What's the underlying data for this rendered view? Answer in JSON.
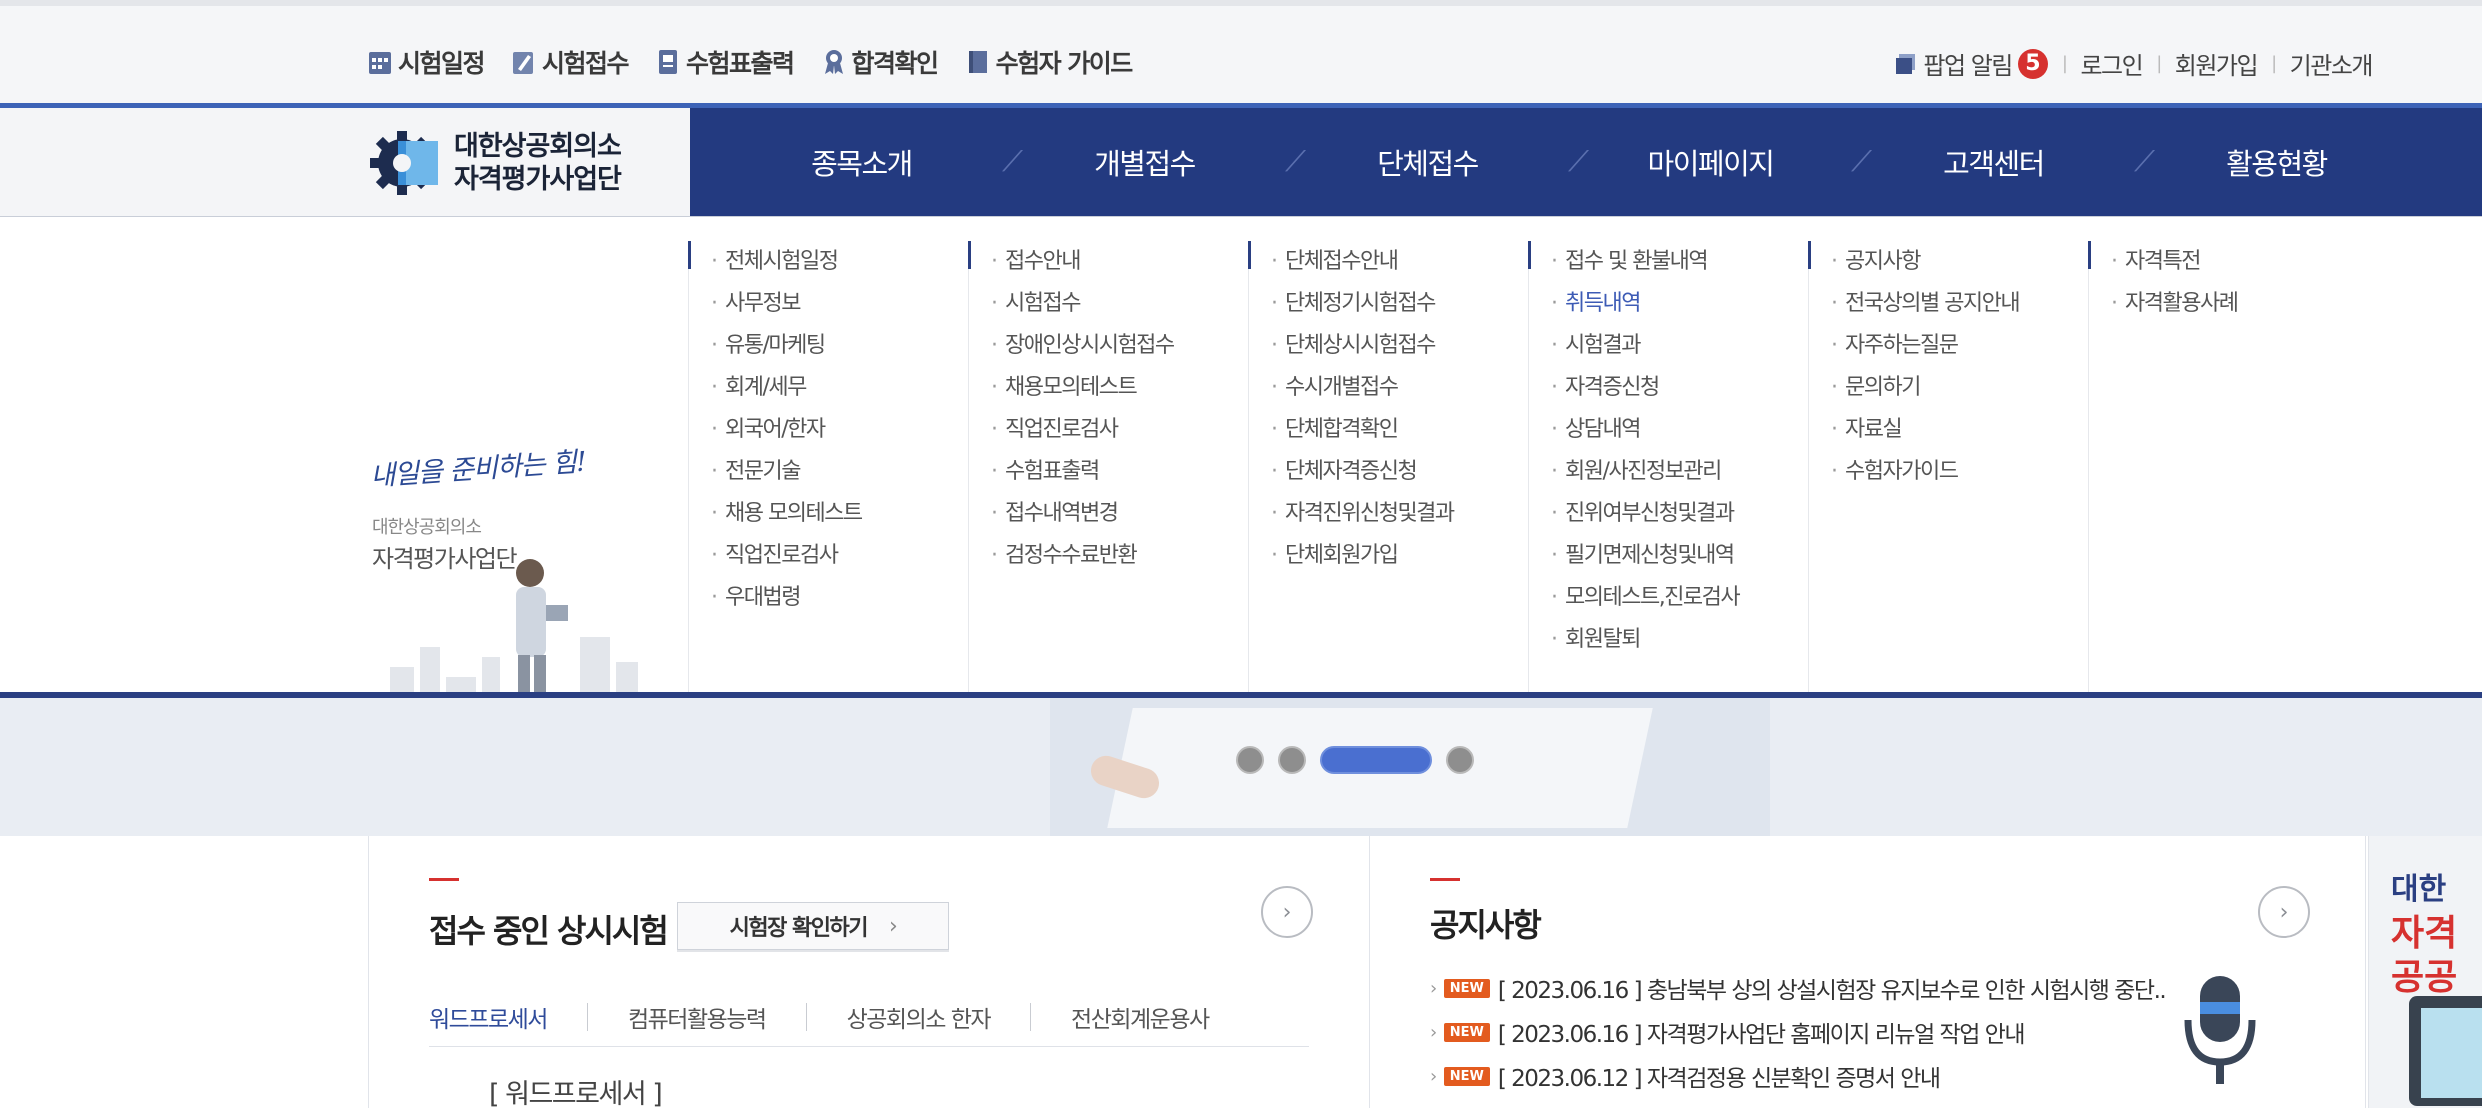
{
  "quick_links": [
    {
      "label": "시험일정",
      "icon": "calendar-icon"
    },
    {
      "label": "시험접수",
      "icon": "edit-icon"
    },
    {
      "label": "수험표출력",
      "icon": "id-card-icon"
    },
    {
      "label": "합격확인",
      "icon": "ribbon-icon"
    },
    {
      "label": "수험자 가이드",
      "icon": "book-icon"
    }
  ],
  "account": {
    "popup_label": "팝업 알림",
    "popup_count": "5",
    "login": "로그인",
    "signup": "회원가입",
    "about": "기관소개"
  },
  "logo": {
    "line1": "대한상공회의소",
    "line2": "자격평가사업단"
  },
  "menu": [
    "종목소개",
    "개별접수",
    "단체접수",
    "마이페이지",
    "고객센터",
    "활용현황"
  ],
  "submenu": [
    [
      "전체시험일정",
      "사무정보",
      "유통/마케팅",
      "회계/세무",
      "외국어/한자",
      "전문기술",
      "채용 모의테스트",
      "직업진로검사",
      "우대법령"
    ],
    [
      "접수안내",
      "시험접수",
      "장애인상시시험접수",
      "채용모의테스트",
      "직업진로검사",
      "수험표출력",
      "접수내역변경",
      "검정수수료반환"
    ],
    [
      "단체접수안내",
      "단체정기시험접수",
      "단체상시시험접수",
      "수시개별접수",
      "단체합격확인",
      "단체자격증신청",
      "자격진위신청및결과",
      "단체회원가입"
    ],
    [
      "접수 및 환불내역",
      "취득내역",
      "시험결과",
      "자격증신청",
      "상담내역",
      "회원/사진정보관리",
      "진위여부신청및결과",
      "필기면제신청및내역",
      "모의테스트,진로검사",
      "회원탈퇴"
    ],
    [
      "공지사항",
      "전국상의별 공지안내",
      "자주하는질문",
      "문의하기",
      "자료실",
      "수험자가이드"
    ],
    [
      "자격특전",
      "자격활용사례"
    ]
  ],
  "submenu_active": "취득내역",
  "promo": {
    "script": "내일을 준비하는 힘!",
    "org1": "대한상공회의소",
    "org2": "자격평가사업단"
  },
  "slider": {
    "count": 4,
    "active": 3
  },
  "exams": {
    "title": "접수 중인 상시시험",
    "venue_button": "시험장 확인하기",
    "tabs": [
      "워드프로세서",
      "컴퓨터활용능력",
      "상공회의소 한자",
      "전산회계운용사"
    ],
    "active_tab": "워드프로세서",
    "subtitle": "[ 워드프로세서 ]"
  },
  "notices": {
    "title": "공지사항",
    "new_tag": "NEW",
    "items": [
      "[ 2023.06.16 ] 충남북부 상의 상설시험장 유지보수로 인한 시험시행 중단..",
      "[ 2023.06.16 ] 자격평가사업단 홈페이지 리뉴얼 작업 안내",
      "[ 2023.06.12 ] 자격검정용 신분확인 증명서 안내"
    ]
  },
  "side_banner": {
    "line1": "대한",
    "line2": "자격",
    "line3": "공공"
  },
  "colors": {
    "navy": "#233a80",
    "accent_blue": "#3d63b7",
    "red": "#d6312f",
    "new_orange": "#e35b1f"
  }
}
